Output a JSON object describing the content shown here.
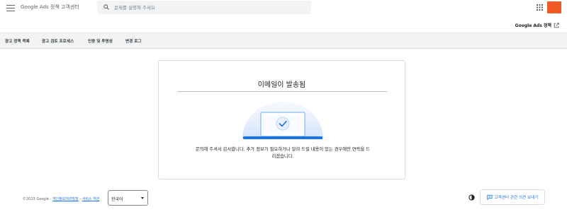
{
  "header": {
    "brand": "Google Ads 정책 고객센터",
    "search_placeholder": "문제를 설명해 주세요",
    "avatar_color": "#f05a24"
  },
  "policy_link": {
    "label": "Google Ads 정책",
    "icon": "open-in-new-icon"
  },
  "nav": {
    "items": [
      {
        "label": "광고 정책 목록"
      },
      {
        "label": "광고 검토 프로세스"
      },
      {
        "label": "인증 및 투명성"
      },
      {
        "label": "변경 로그"
      }
    ]
  },
  "card": {
    "title": "이메일이 발송됨",
    "message": "문의해 주셔서 감사합니다. 추가 정보가 필요하거나 알려 드릴 내용이 있는 경우에만 연락을 드리겠습니다.",
    "illustration": "laptop-checkmark-icon",
    "accent_color": "#1a73e8"
  },
  "footer": {
    "copyright": "©2023 Google",
    "sep1": " - ",
    "privacy_link": "개인정보처리방침",
    "sep2": " - ",
    "terms_link": "서비스 약관",
    "language": "한국어",
    "feedback_label": "고객센터 관련 의견 보내기"
  }
}
